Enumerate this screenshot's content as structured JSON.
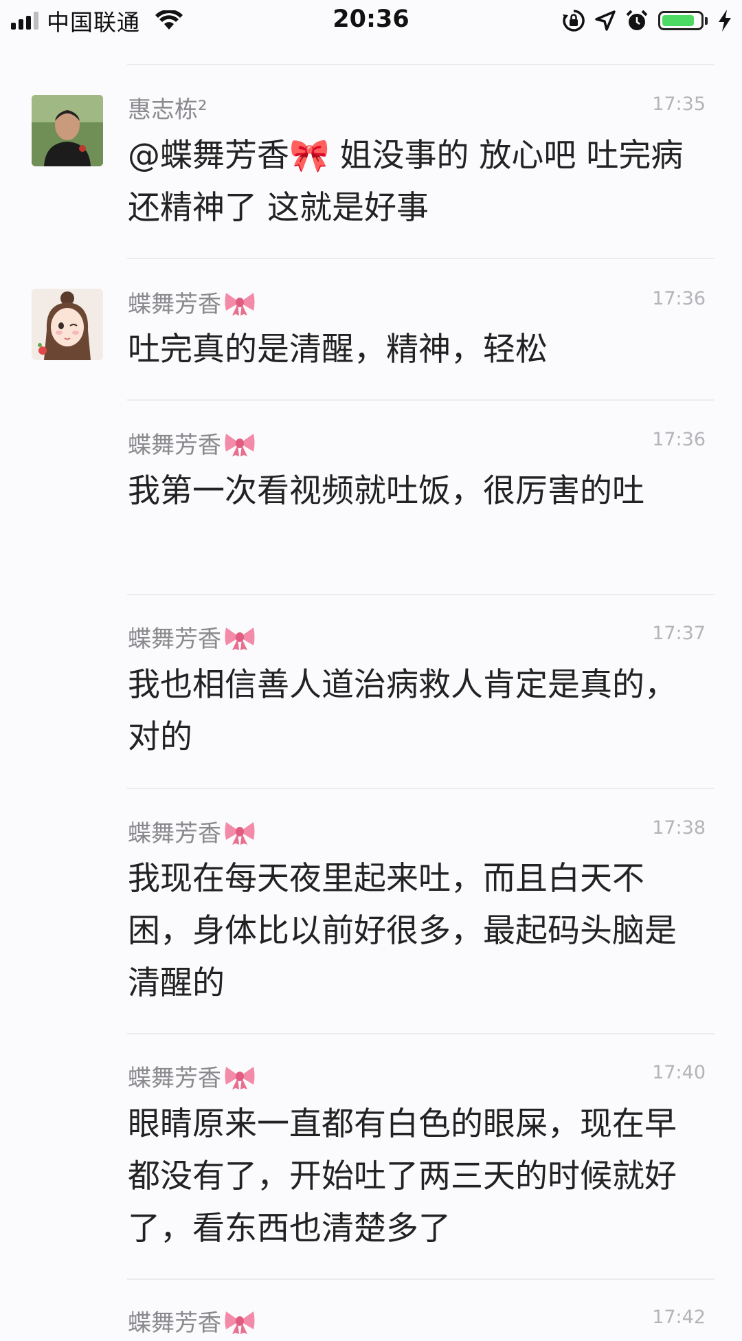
{
  "status_bar": {
    "carrier": "中国联通",
    "time": "20:36",
    "battery_level": 0.85,
    "battery_color": "#4cd964"
  },
  "messages": [
    {
      "sender": "惠志栋²",
      "time": "17:35",
      "text": "@蝶舞芳香🎀 姐没事的 放心吧 吐完病还精神了 这就是好事",
      "has_avatar": true,
      "avatar": "man-photo"
    },
    {
      "sender": "蝶舞芳香",
      "time": "17:36",
      "text": "吐完真的是清醒，精神，轻松",
      "has_avatar": true,
      "avatar": "cartoon-girl"
    },
    {
      "sender": "蝶舞芳香",
      "time": "17:36",
      "text": "我第一次看视频就吐饭，很厉害的吐",
      "has_avatar": false
    },
    {
      "sender": "蝶舞芳香",
      "time": "17:37",
      "text": "我也相信善人道治病救人肯定是真的，对的",
      "has_avatar": false
    },
    {
      "sender": "蝶舞芳香",
      "time": "17:38",
      "text": "我现在每天夜里起来吐，而且白天不困，身体比以前好很多，最起码头脑是清醒的",
      "has_avatar": false
    },
    {
      "sender": "蝶舞芳香",
      "time": "17:40",
      "text": "眼睛原来一直都有白色的眼屎，现在早都没有了，开始吐了两三天的时候就好了，看东西也清楚多了",
      "has_avatar": false
    },
    {
      "sender": "蝶舞芳香",
      "time": "17:42",
      "text": "",
      "has_avatar": false
    }
  ]
}
